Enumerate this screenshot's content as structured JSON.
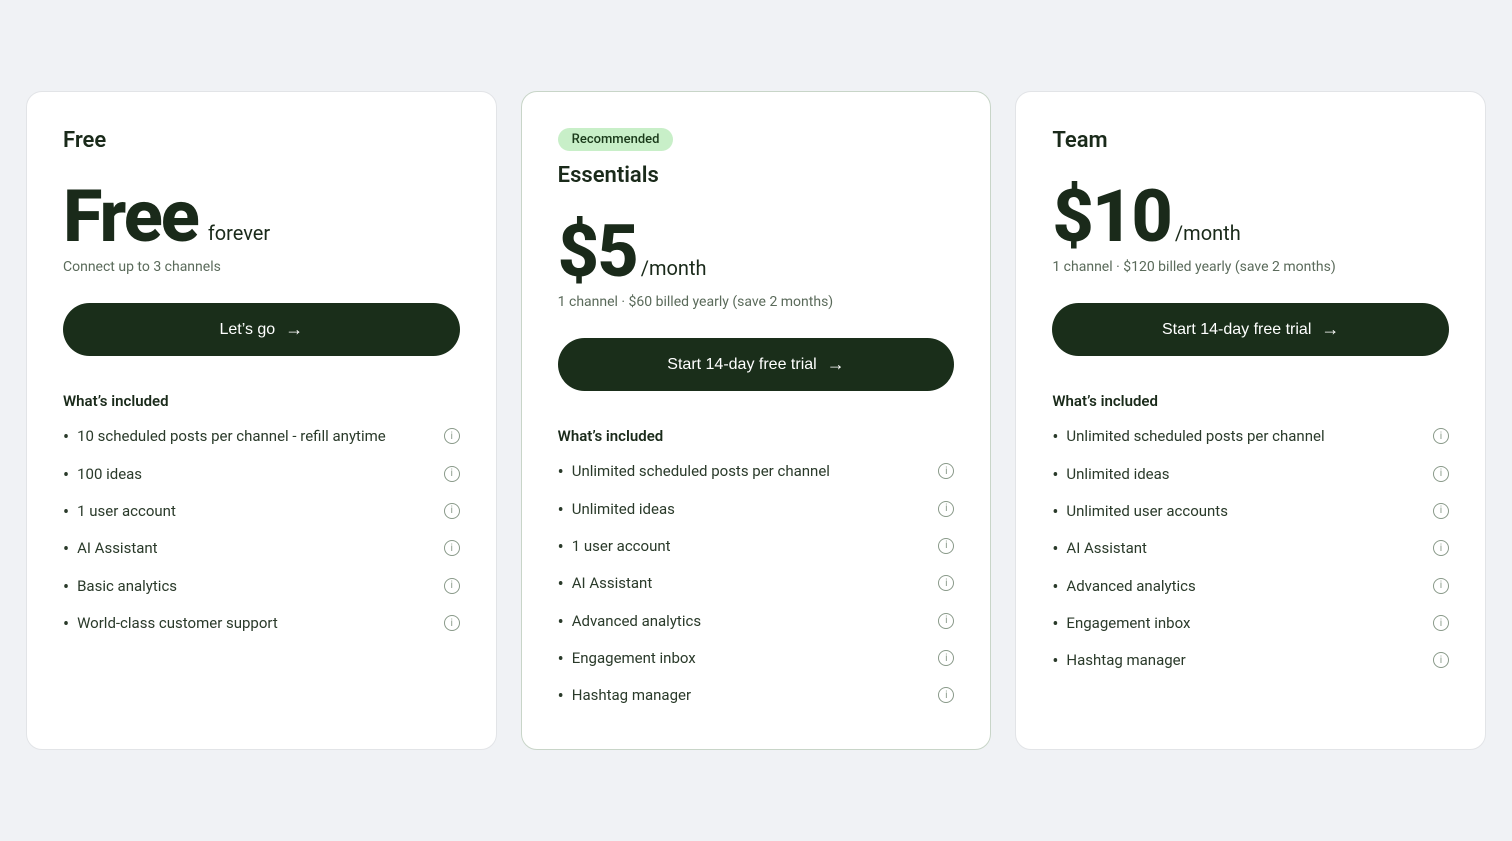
{
  "plans": [
    {
      "id": "free",
      "name": "Free",
      "recommended": false,
      "recommended_label": "",
      "price_display": "Free",
      "price_suffix": "forever",
      "price_subtitle": "Connect up to 3 channels",
      "cta_label": "Let’s go",
      "cta_arrow": "→",
      "features_label": "What’s included",
      "features": [
        "10 scheduled posts per channel - refill anytime",
        "100 ideas",
        "1 user account",
        "AI Assistant",
        "Basic analytics",
        "World-class customer support"
      ]
    },
    {
      "id": "essentials",
      "name": "Essentials",
      "recommended": true,
      "recommended_label": "Recommended",
      "price_display": "$5",
      "price_suffix": "/month",
      "price_subtitle": "1 channel · $60 billed yearly (save 2 months)",
      "cta_label": "Start 14-day free trial",
      "cta_arrow": "→",
      "features_label": "What’s included",
      "features": [
        "Unlimited scheduled posts per channel",
        "Unlimited ideas",
        "1 user account",
        "AI Assistant",
        "Advanced analytics",
        "Engagement inbox",
        "Hashtag manager"
      ]
    },
    {
      "id": "team",
      "name": "Team",
      "recommended": false,
      "recommended_label": "",
      "price_display": "$10",
      "price_suffix": "/month",
      "price_subtitle": "1 channel · $120 billed yearly (save 2 months)",
      "cta_label": "Start 14-day free trial",
      "cta_arrow": "→",
      "features_label": "What’s included",
      "features": [
        "Unlimited scheduled posts per channel",
        "Unlimited ideas",
        "Unlimited user accounts",
        "AI Assistant",
        "Advanced analytics",
        "Engagement inbox",
        "Hashtag manager"
      ]
    }
  ],
  "icons": {
    "info": "i",
    "arrow": "→"
  }
}
